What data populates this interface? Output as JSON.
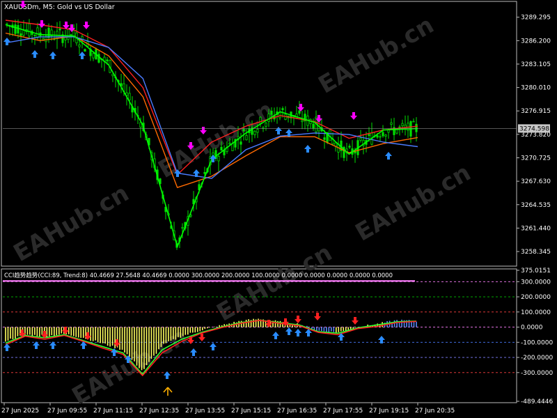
{
  "window": {
    "title": "XAUUSDm, M5:  Gold vs US Dollar"
  },
  "price_pane": {
    "axis_labels": [
      "3289.295",
      "3286.200",
      "3283.105",
      "3280.010",
      "3276.915",
      "3273.820",
      "3270.725",
      "3267.630",
      "3264.535",
      "3261.440",
      "3258.345"
    ],
    "current_price_label": "3274.598",
    "current_price": 3274.598,
    "colors": {
      "bull": "#00e000",
      "red_line": "#ff2020",
      "orange_line": "#ff6a00",
      "blue_line": "#4a7bff",
      "green_line": "#00ff00",
      "up_arrow": "#2a8cff",
      "down_arrow": "#ff00ff"
    }
  },
  "indicator_pane": {
    "title": "CCI趋势趋势(CCI:89, Trend:8) 40.4669 27.5648 40.4669 0.0000 300.0000 200.0000 100.0000 0.0000 0.0000 0.0000 0.0000 0.0000",
    "axis_labels": [
      "375.0151",
      "300.0000",
      "200.0000",
      "100.0000",
      "0.0000",
      "-100.0000",
      "-200.0000",
      "-300.0000",
      "-489.4446"
    ],
    "levels": [
      300,
      200,
      100,
      0,
      -100,
      -200,
      -300
    ],
    "level_colors": [
      "#ff80ff",
      "#00c000",
      "#ff4040",
      "#ff80ff",
      "#4a7bff",
      "#8080ff",
      "#ff4040"
    ],
    "colors": {
      "hist_bull": "#ffff60",
      "hist_bear": "#5a8cff",
      "up_arrow": "#2a8cff",
      "down_arrow": "#ff2020",
      "signal_arrow": "#ffb000"
    }
  },
  "time_axis": {
    "labels": [
      "27 Jun 2025",
      "27 Jun 09:55",
      "27 Jun 11:15",
      "27 Jun 12:35",
      "27 Jun 13:55",
      "27 Jun 15:15",
      "27 Jun 16:35",
      "27 Jun 17:55",
      "27 Jun 19:15",
      "27 Jun 20:35"
    ]
  },
  "watermark": {
    "text": "EAHub.cn"
  },
  "chart_data": [
    {
      "type": "line",
      "title": "XAUUSDm, M5:  Gold vs US Dollar",
      "x": [
        "27 Jun 2025",
        "27 Jun 09:55",
        "27 Jun 11:15",
        "27 Jun 12:35",
        "27 Jun 13:55",
        "27 Jun 15:15",
        "27 Jun 16:35",
        "27 Jun 17:55",
        "27 Jun 19:15",
        "27 Jun 20:35"
      ],
      "ylim": [
        3256.6,
        3291.2
      ],
      "series": [
        {
          "values": [
            3288.9,
            3288.3,
            3287.6,
            3285.3,
            3280.0,
            3268.5,
            3272.8,
            3274.9,
            3276.3,
            3275.5,
            3273.3,
            3274.4,
            3274.9
          ]
        },
        {
          "values": [
            3287.2,
            3286.2,
            3286.8,
            3284.2,
            3278.8,
            3266.8,
            3268.3,
            3271.0,
            3273.5,
            3273.5,
            3271.4,
            3272.6,
            3273.4
          ]
        },
        {
          "values": [
            3285.9,
            3286.7,
            3286.7,
            3285.3,
            3281.2,
            3268.7,
            3268.0,
            3271.8,
            3273.6,
            3274.0,
            3273.8,
            3272.8,
            3272.2
          ]
        },
        {
          "values": [
            3288.3,
            3287.0,
            3286.8,
            3283.0,
            3275.0,
            3259.0,
            3270.5,
            3274.0,
            3276.8,
            3275.4,
            3271.2,
            3274.4,
            3274.6
          ]
        }
      ]
    },
    {
      "type": "bar",
      "title": "CCI趋势趋势(CCI:89, Trend:8) 40.4669 27.5648 40.4669 0.0000 300.0000 200.0000 100.0000 0.0000 0.0000 0.0000 0.0000 0.0000",
      "ylim": [
        -489.4446,
        375.0151
      ],
      "values": [
        -90,
        -50,
        -60,
        -45,
        -70,
        -110,
        -150,
        -290,
        -120,
        -60,
        -20,
        10,
        40,
        55,
        35,
        20,
        -25,
        -35,
        0,
        20,
        45,
        40
      ],
      "series": [
        {
          "values": [
            -105,
            -55,
            -70,
            -50,
            -90,
            -130,
            -170,
            -310,
            -150,
            -80,
            -35,
            0,
            30,
            45,
            30,
            15,
            -30,
            -40,
            -5,
            15,
            35,
            40
          ]
        },
        {
          "values": [
            -115,
            -60,
            -80,
            -55,
            -95,
            -140,
            -180,
            -320,
            -170,
            -95,
            -40,
            -5,
            25,
            45,
            25,
            10,
            -35,
            -50,
            -10,
            5,
            30,
            38
          ]
        }
      ]
    }
  ]
}
